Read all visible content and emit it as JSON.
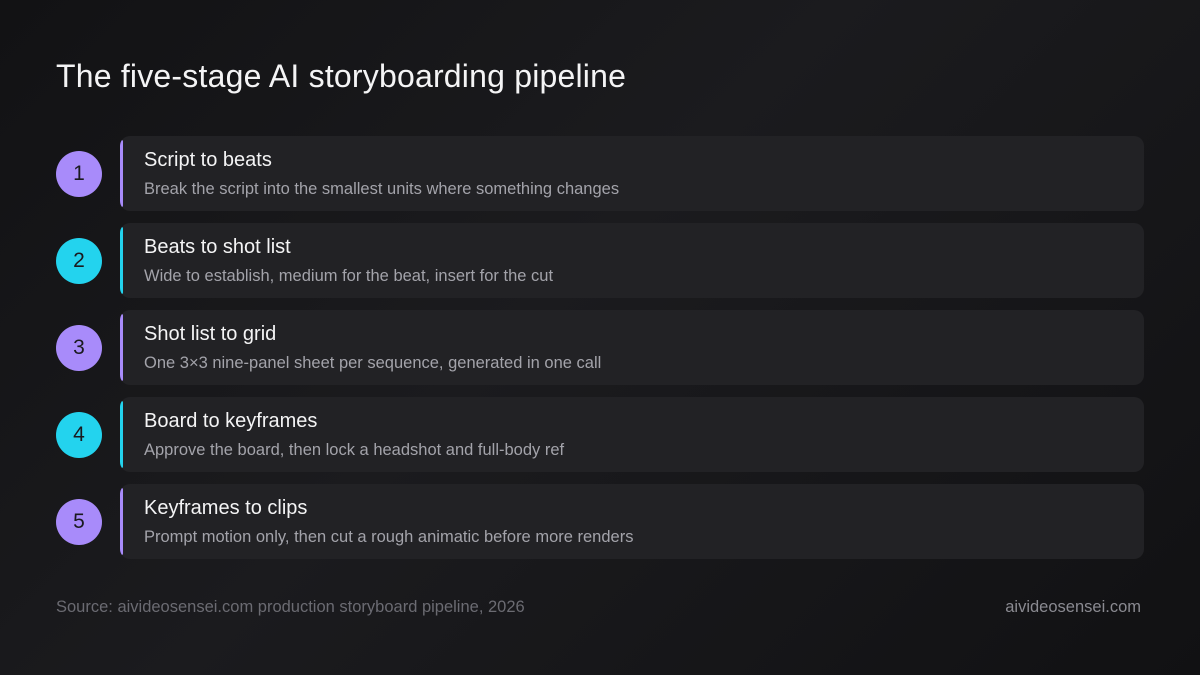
{
  "title": "The five-stage AI storyboarding pipeline",
  "colors": {
    "purple": "#a88bfa",
    "cyan": "#23d3ee",
    "card": "#222225",
    "background": "#141416"
  },
  "stages": [
    {
      "number": "1",
      "title": "Script to beats",
      "description": "Break the script into the smallest units where something changes",
      "color": "purple"
    },
    {
      "number": "2",
      "title": "Beats to shot list",
      "description": "Wide to establish, medium for the beat, insert for the cut",
      "color": "cyan"
    },
    {
      "number": "3",
      "title": "Shot list to grid",
      "description": "One 3×3 nine-panel sheet per sequence, generated in one call",
      "color": "purple"
    },
    {
      "number": "4",
      "title": "Board to keyframes",
      "description": "Approve the board, then lock a headshot and full-body ref",
      "color": "cyan"
    },
    {
      "number": "5",
      "title": "Keyframes to clips",
      "description": "Prompt motion only, then cut a rough animatic before more renders",
      "color": "purple"
    }
  ],
  "footer": {
    "source": "Source: aivideosensei.com production storyboard pipeline, 2026",
    "site": "aivideosensei.com"
  }
}
